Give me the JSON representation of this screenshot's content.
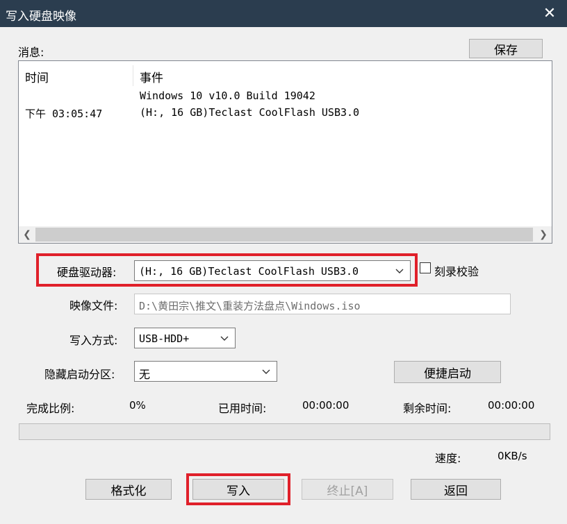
{
  "window": {
    "title": "写入硬盘映像",
    "close_glyph": "✕"
  },
  "messages": {
    "label": "消息:",
    "save_label": "保存",
    "columns": {
      "time": "时间",
      "event": "事件"
    },
    "rows": [
      {
        "time": "",
        "event": "Windows 10 v10.0 Build 19042"
      },
      {
        "time": "下午 03:05:47",
        "event": "(H:, 16 GB)Teclast CoolFlash USB3.0"
      }
    ]
  },
  "drive": {
    "label": "硬盘驱动器:",
    "value": "(H:, 16 GB)Teclast CoolFlash USB3.0"
  },
  "verify": {
    "label": "刻录校验",
    "checked": false
  },
  "image_file": {
    "label": "映像文件:",
    "value": "D:\\黄田宗\\推文\\重装方法盘点\\Windows.iso"
  },
  "write_method": {
    "label": "写入方式:",
    "value": "USB-HDD+"
  },
  "hidden_partition": {
    "label": "隐藏启动分区:",
    "value": "无"
  },
  "quick_boot_label": "便捷启动",
  "stats": {
    "complete_label": "完成比例:",
    "complete_value": "0%",
    "progress_fraction": 0,
    "elapsed_label": "已用时间:",
    "elapsed_value": "00:00:00",
    "remaining_label": "剩余时间:",
    "remaining_value": "00:00:00",
    "speed_label": "速度:",
    "speed_value": "0KB/s"
  },
  "buttons": {
    "format": "格式化",
    "write": "写入",
    "stop": "终止[A]",
    "back": "返回"
  },
  "colors": {
    "titlebar": "#2b3d4f",
    "highlight": "#e0202a",
    "progress": "#06b025"
  }
}
